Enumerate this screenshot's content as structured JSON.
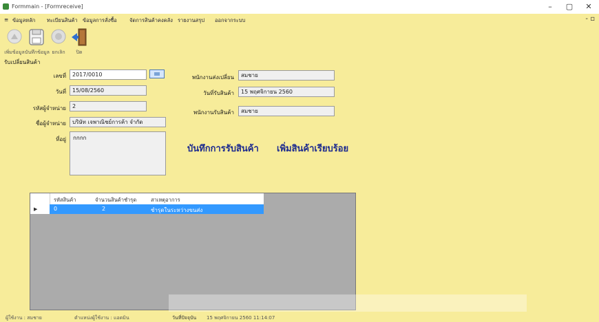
{
  "window": {
    "title": "Formmain - [Formreceive]",
    "minimize": "–",
    "maximize": "▢",
    "close": "✕",
    "mdi_controls": "- ▫"
  },
  "menu": {
    "items": [
      "ข้อมูลหลัก",
      "ทะเบียนสินค้า",
      "ข้อมูลการสั่งซื้อ",
      "จัดการสินค้าคงคลัง",
      "รายงานสรุป",
      "ออกจากระบบ"
    ]
  },
  "toolbar": {
    "buttons": [
      {
        "label": "เพิ่มข้อมูล",
        "icon": "add-icon"
      },
      {
        "label": "บันทึกข้อมูล",
        "icon": "save-icon"
      },
      {
        "label": "ยกเลิก",
        "icon": "cancel-icon"
      },
      {
        "label": "ปิด",
        "icon": "exit-door-icon"
      }
    ]
  },
  "form": {
    "section_title": "รับเปลี่ยนสินค้า",
    "doc_no_label": "เลขที่",
    "doc_no_value": "2017/0010",
    "date_label": "วันที่",
    "date_value": "15/08/2560",
    "supplier_code_label": "รหัสผู้จำหน่าย",
    "supplier_code_value": "2",
    "supplier_name_label": "ชื่อผู้จำหน่าย",
    "supplier_name_value": "บริษัท เจพาณิชย์การค้า จำกัด",
    "note_label": "ที่อยู่",
    "note_value": "กกกก",
    "order_officer_label": "พนักงานส่งเปลี่ยน",
    "order_officer_value": "สมชาย",
    "receive_date_label": "วันที่รับสินค้า",
    "receive_date_value": "15 พฤศจิกายน 2560",
    "receiver_label": "พนักงานรับสินค้า",
    "receiver_value": "สมชาย",
    "link_save": "บันทึกการรับสินค้า",
    "link_add": "เพิ่มสินค้าเรียบร้อย"
  },
  "grid": {
    "columns": [
      "รหัสสินค้า",
      "จำนวนสินค้าชำรุด",
      "สาเหตุอาการ"
    ],
    "rows": [
      {
        "code": "0",
        "qty": "2",
        "reason": "ชำรุดในระหว่างขนส่ง"
      }
    ]
  },
  "status": {
    "items": [
      "ผู้ใช้งาน : สมชาย",
      "ตำแหน่งผู้ใช้งาน : แอดมิน",
      "วันที่ปัจจุบัน",
      "15 พฤศจิกายน 2560 11:14:07"
    ]
  },
  "colors": {
    "background": "#f7ec9a",
    "selection": "#3399ff",
    "link": "#1c2a8e"
  }
}
